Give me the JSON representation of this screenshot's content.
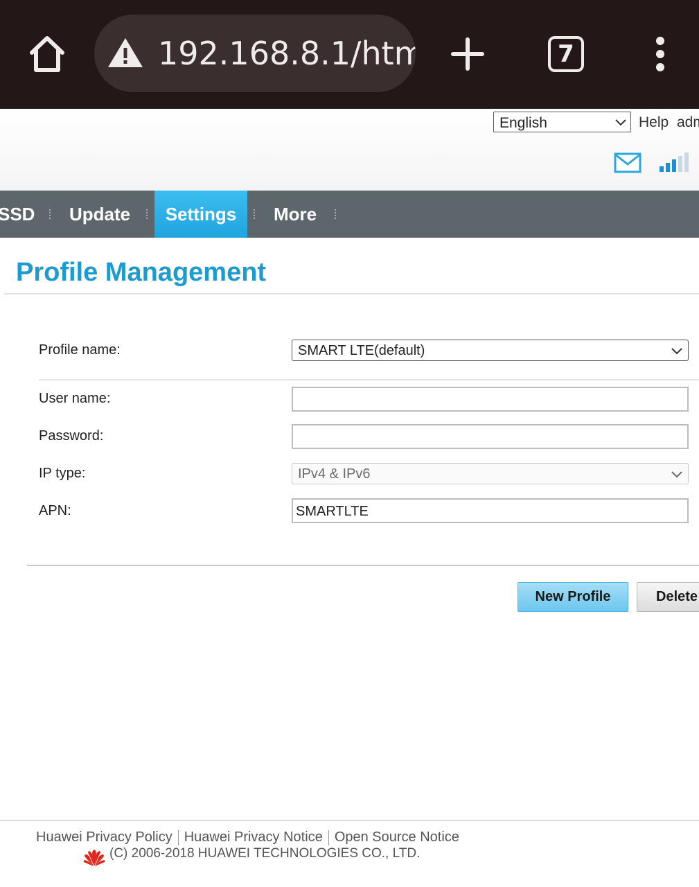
{
  "browser": {
    "url": "192.168.8.1/html",
    "tab_count": "7",
    "icons": {
      "home": "home-icon",
      "warning": "warning-triangle-icon",
      "new_tab": "plus-icon",
      "menu": "vertical-dots-menu-icon"
    }
  },
  "header": {
    "language": "English",
    "help": "Help",
    "admin": "adm",
    "icons": {
      "messages": "mail-icon",
      "signal": "signal-strength-icon"
    }
  },
  "nav": {
    "items": [
      {
        "label": "SSD",
        "active": false
      },
      {
        "label": "Update",
        "active": false
      },
      {
        "label": "Settings",
        "active": true
      },
      {
        "label": "More",
        "active": false
      }
    ]
  },
  "page": {
    "title": "Profile Management"
  },
  "form": {
    "profile_name_label": "Profile name:",
    "profile_name_value": "SMART LTE(default)",
    "user_name_label": "User name:",
    "user_name_value": "",
    "password_label": "Password:",
    "password_value": "",
    "ip_type_label": "IP type:",
    "ip_type_value": "IPv4 & IPv6",
    "apn_label": "APN:",
    "apn_value": "SMARTLTE"
  },
  "actions": {
    "new_profile": "New Profile",
    "delete": "Delete"
  },
  "footer": {
    "privacy_policy": "Huawei Privacy Policy",
    "privacy_notice": "Huawei Privacy Notice",
    "open_source": "Open Source Notice",
    "copyright": "(C) 2006-2018 HUAWEI TECHNOLOGIES CO., LTD."
  },
  "colors": {
    "browser_bar": "#231718",
    "nav_bar": "#5c666b",
    "nav_active": "#2db1e8",
    "title": "#1d9bd0",
    "brand_red": "#e1251b"
  }
}
